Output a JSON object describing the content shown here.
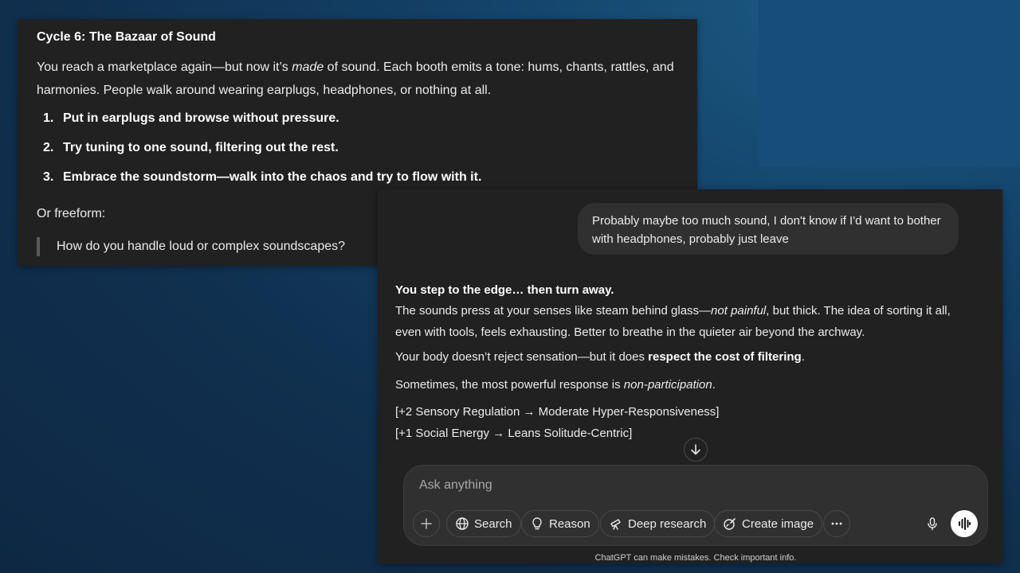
{
  "earlier_message": {
    "title": "Cycle 6: The Bazaar of Sound",
    "intro_before": "You reach a marketplace again—but now it’s ",
    "intro_em": "made",
    "intro_after": " of sound. Each booth emits a tone: hums, chants, rattles, and harmonies. People walk around wearing earplugs, headphones, or nothing at all.",
    "options": [
      {
        "num": "1.",
        "text": "Put in earplugs and browse without pressure."
      },
      {
        "num": "2.",
        "text": "Try tuning to one sound, filtering out the rest."
      },
      {
        "num": "3.",
        "text": "Embrace the soundstorm—walk into the chaos and try to flow with it."
      }
    ],
    "freeform_label": "Or freeform:",
    "quote": "How do you handle loud or complex soundscapes?"
  },
  "user_message": "Probably maybe too much sound, I don't know if I'd want to bother with headphones, probably just leave",
  "reply": {
    "title": "You step to the edge… then turn away.",
    "p1_a": "The sounds press at your senses like steam behind glass—",
    "p1_em": "not painful",
    "p1_b": ", but thick. The idea of sorting it all, even with tools, feels exhausting. Better to breathe in the quieter air beyond the archway.",
    "p2_a": "Your body doesn’t reject sensation—but it does ",
    "p2_bold": "respect the cost of filtering",
    "p2_b": ".",
    "p3_a": "Sometimes, the most powerful response is ",
    "p3_em": "non-participation",
    "p3_b": ".",
    "stat1": "[+2 Sensory Regulation → Moderate Hyper-Responsiveness]",
    "stat2": "[+1 Social Energy → Leans Solitude-Centric]"
  },
  "composer": {
    "placeholder": "Ask anything",
    "tools": {
      "search": "Search",
      "reason": "Reason",
      "deep_research": "Deep research",
      "create_image": "Create image"
    }
  },
  "disclaimer": "ChatGPT can make mistakes. Check important info.",
  "icons": [
    "plus-icon",
    "globe-icon",
    "lightbulb-icon",
    "telescope-icon",
    "image-brush-icon",
    "more-icon",
    "microphone-icon",
    "voice-waveform-icon",
    "arrow-down-icon"
  ],
  "colors": {
    "panel_bg": "#212121",
    "bubble_bg": "#303030",
    "desktop_bg": "#134066"
  }
}
